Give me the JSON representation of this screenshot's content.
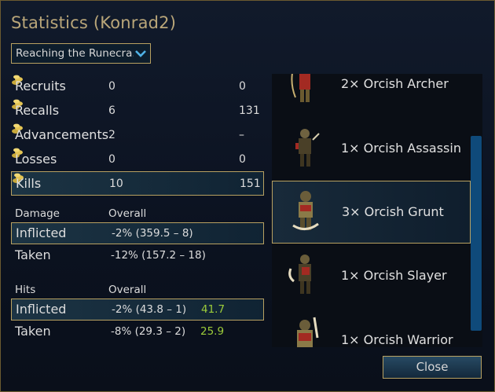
{
  "window": {
    "title": "Statistics (Konrad2)"
  },
  "scenario_select": {
    "value": "Reaching the Runecra..."
  },
  "summary": [
    {
      "name": "Recruits",
      "count": "0",
      "gold": "0"
    },
    {
      "name": "Recalls",
      "count": "6",
      "gold": "131"
    },
    {
      "name": "Advancements",
      "count": "2",
      "gold": "–"
    },
    {
      "name": "Losses",
      "count": "0",
      "gold": "0"
    },
    {
      "name": "Kills",
      "count": "10",
      "gold": "151"
    }
  ],
  "damage": {
    "header": "Damage",
    "col": "Overall",
    "inflicted": {
      "label": "Inflicted",
      "value": "-2% (359.5 – 8)"
    },
    "taken": {
      "label": "Taken",
      "value": "-12% (157.2 – 18)"
    }
  },
  "hits": {
    "header": "Hits",
    "col": "Overall",
    "inflicted": {
      "label": "Inflicted",
      "value": "-2% (43.8 – 1)",
      "extra": "41.7"
    },
    "taken": {
      "label": "Taken",
      "value": "-8% (29.3 – 2)",
      "extra": "25.9"
    }
  },
  "units": [
    {
      "label": "2× Orcish Archer",
      "icon": "orcish-archer-sprite"
    },
    {
      "label": "1× Orcish Assassin",
      "icon": "orcish-assassin-sprite"
    },
    {
      "label": "3× Orcish Grunt",
      "icon": "orcish-grunt-sprite",
      "selected": true
    },
    {
      "label": "1× Orcish Slayer",
      "icon": "orcish-slayer-sprite"
    },
    {
      "label": "1× Orcish Warrior",
      "icon": "orcish-warrior-sprite"
    }
  ],
  "buttons": {
    "close": "Close"
  },
  "colors": {
    "accent_gold": "#b8a161",
    "title": "#b9a679",
    "positive": "#9ccc3a"
  }
}
